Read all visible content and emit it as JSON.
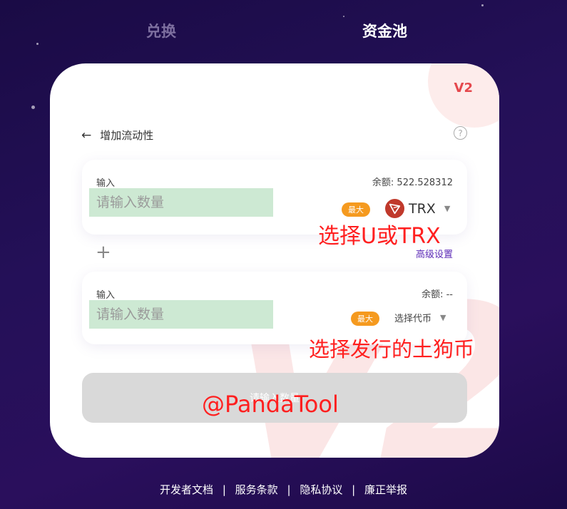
{
  "nav": {
    "tabs": [
      {
        "label": "兑换",
        "active": false
      },
      {
        "label": "资金池",
        "active": true
      }
    ]
  },
  "card": {
    "version_badge": "V2",
    "header": {
      "back_icon": "arrow-left-icon",
      "title": "增加流动性",
      "help_icon": "question-circle-icon"
    },
    "input_a": {
      "label": "输入",
      "balance": "余额: 522.528312",
      "placeholder": "请输入数量",
      "max_label": "最大",
      "token": "TRX",
      "token_icon": "trx-logo-icon"
    },
    "plus_icon": "plus-icon",
    "advanced_settings": "高级设置",
    "input_b": {
      "label": "输入",
      "balance": "余额: --",
      "placeholder": "请输入数量",
      "max_label": "最大",
      "token": "选择代币"
    },
    "submit_label": "请输入数量"
  },
  "annotations": {
    "select_token_a": "选择U或TRX",
    "select_token_b": "选择发行的土狗币",
    "watermark": "@PandaTool"
  },
  "footer": {
    "links": [
      "开发者文档",
      "服务条款",
      "隐私协议",
      "廉正举报"
    ],
    "separator": "|"
  },
  "colors": {
    "accent": "#5b2ab6",
    "max_badge": "#f59a1f",
    "version_badge": "#e5484d",
    "input_highlight": "#cde9d3",
    "annotation": "#ff1f1f"
  }
}
